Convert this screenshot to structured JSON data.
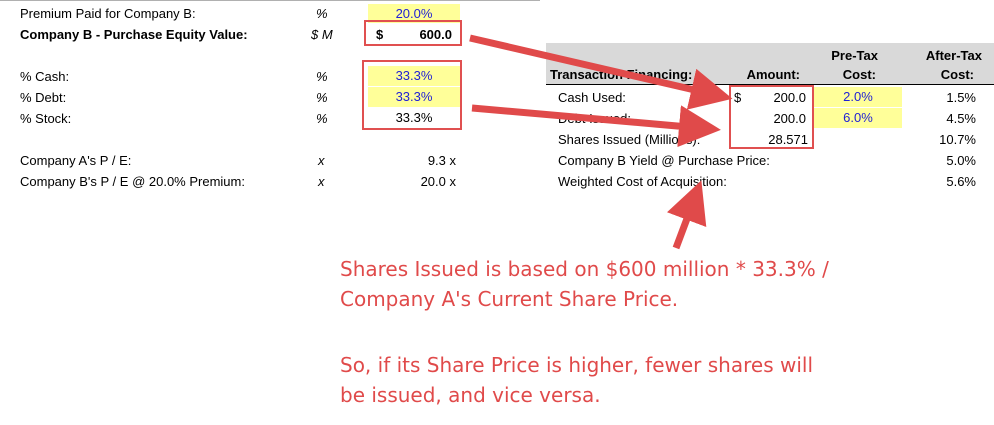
{
  "left": {
    "premium": {
      "label": "Premium Paid for Company B:",
      "unit": "%",
      "value": "20.0%"
    },
    "equity": {
      "label": "Company B - Purchase Equity Value:",
      "unit": "$ M",
      "currency": "$",
      "value": "600.0"
    },
    "cash": {
      "label": "% Cash:",
      "unit": "%",
      "value": "33.3%"
    },
    "debt": {
      "label": "% Debt:",
      "unit": "%",
      "value": "33.3%"
    },
    "stock": {
      "label": "% Stock:",
      "unit": "%",
      "value": "33.3%"
    },
    "pe_a": {
      "label": "Company A's P / E:",
      "unit": "x",
      "value": "9.3 x"
    },
    "pe_b": {
      "label": "Company B's P / E @ 20.0% Premium:",
      "unit": "x",
      "value": "20.0 x"
    }
  },
  "right": {
    "headers": {
      "financing": "Transaction Financing:",
      "amount": "Amount:",
      "pretax_1": "Pre-Tax",
      "pretax_2": "Cost:",
      "aftertax_1": "After-Tax",
      "aftertax_2": "Cost:"
    },
    "cash_used": {
      "label": "Cash Used:",
      "currency": "$",
      "amount": "200.0",
      "pretax": "2.0%",
      "aftertax": "1.5%"
    },
    "debt_issued": {
      "label": "Debt Issued:",
      "amount": "200.0",
      "pretax": "6.0%",
      "aftertax": "4.5%"
    },
    "shares_issued": {
      "label": "Shares Issued (Millions):",
      "amount": "28.571",
      "aftertax": "10.7%"
    },
    "yield": {
      "label": "Company B Yield @ Purchase Price:",
      "value": "5.0%"
    },
    "wcoa": {
      "label": "Weighted Cost of Acquisition:",
      "value": "5.6%"
    }
  },
  "annotation": {
    "line1": "Shares Issued is based on $600 million * 33.3% /",
    "line2": "Company A's Current Share Price.",
    "line3": "So, if its Share Price is higher, fewer shares will",
    "line4": "be issued, and vice versa."
  },
  "colors": {
    "accent_red": "#e04a4a",
    "input_yellow": "#ffff99",
    "input_blue": "#1f1fd6",
    "header_gray": "#d9d9d9"
  }
}
